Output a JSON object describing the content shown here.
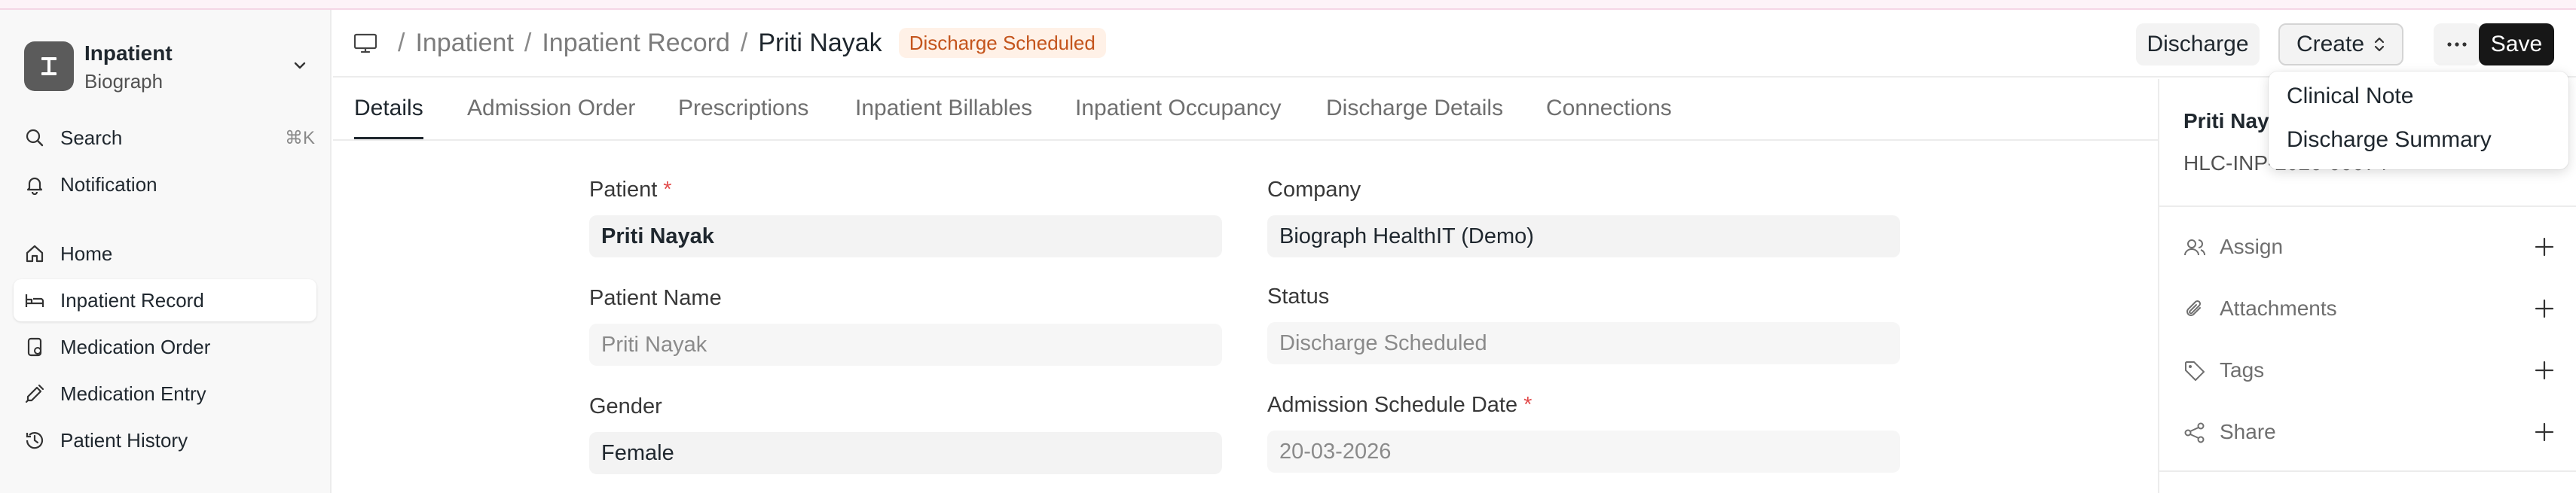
{
  "sidebar": {
    "app": {
      "title": "Inpatient",
      "subtitle": "Biograph",
      "logo_letter": "I"
    },
    "search": {
      "label": "Search",
      "shortcut": "⌘K"
    },
    "notification": {
      "label": "Notification"
    },
    "items": [
      {
        "label": "Home",
        "icon": "home-icon",
        "active": false
      },
      {
        "label": "Inpatient Record",
        "icon": "bed-icon",
        "active": true
      },
      {
        "label": "Medication Order",
        "icon": "pill-icon",
        "active": false
      },
      {
        "label": "Medication Entry",
        "icon": "syringe-icon",
        "active": false
      },
      {
        "label": "Patient History",
        "icon": "history-icon",
        "active": false
      }
    ]
  },
  "header": {
    "breadcrumbs": [
      "Inpatient",
      "Inpatient Record",
      "Priti Nayak"
    ],
    "status_badge": "Discharge Scheduled",
    "buttons": {
      "discharge": "Discharge",
      "create": "Create",
      "more": "···",
      "save": "Save"
    }
  },
  "tabs": [
    "Details",
    "Admission Order",
    "Prescriptions",
    "Inpatient Billables",
    "Inpatient Occupancy",
    "Discharge Details",
    "Connections"
  ],
  "active_tab": "Details",
  "form": {
    "patient": {
      "label": "Patient",
      "required": "*",
      "value": "Priti Nayak"
    },
    "company": {
      "label": "Company",
      "value": "Biograph HealthIT (Demo)"
    },
    "patient_name": {
      "label": "Patient Name",
      "value": "Priti Nayak"
    },
    "status": {
      "label": "Status",
      "value": "Discharge Scheduled"
    },
    "gender": {
      "label": "Gender",
      "value": "Female"
    },
    "admission_schedule_date": {
      "label": "Admission Schedule Date",
      "required": "*",
      "value": "20-03-2026"
    }
  },
  "right_panel": {
    "name": "Priti Nay",
    "id": "HLC-INP-2026-00074",
    "actions": [
      {
        "label": "Assign",
        "icon": "users-icon"
      },
      {
        "label": "Attachments",
        "icon": "paperclip-icon"
      },
      {
        "label": "Tags",
        "icon": "tag-icon"
      },
      {
        "label": "Share",
        "icon": "share-icon"
      }
    ]
  },
  "create_dropdown": {
    "items": [
      "Clinical Note",
      "Discharge Summary"
    ]
  },
  "colors": {
    "badge_bg": "#fff1e7",
    "badge_text": "#c4541c",
    "primary_button": "#171717",
    "required": "#e24c4c"
  }
}
